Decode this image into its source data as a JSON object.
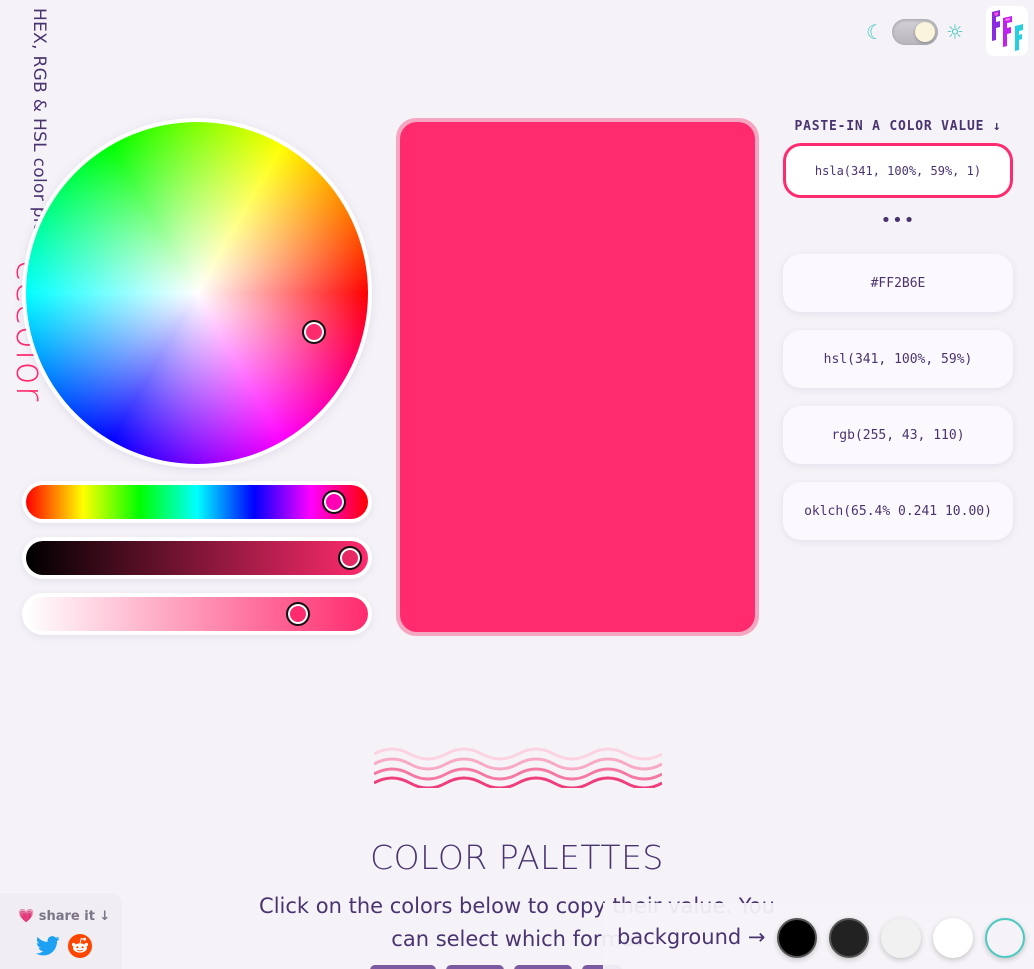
{
  "brand": {
    "name": "cccolor",
    "subtitle": "HEX, RGB & HSL color picker"
  },
  "theme": {
    "moon_glyph": "☾",
    "sun_glyph": "☼",
    "mode": "light"
  },
  "current_color": {
    "hex": "#FF2B6E",
    "display": "#ff2b6e"
  },
  "picker": {
    "hue_handle_color": "#ff2b6e",
    "saturation_level_percent": 100,
    "lightness_level_percent": 59,
    "alpha_level_percent": 100
  },
  "formats": {
    "paste_label": "PASTE-IN A COLOR VALUE ↓",
    "input_value": "hsla(341, 100%, 59%, 1)",
    "more": "•••",
    "items": [
      {
        "label": "#FF2B6E"
      },
      {
        "label": "hsl(341, 100%, 59%)"
      },
      {
        "label": "rgb(255, 43, 110)"
      },
      {
        "label": "oklch(65.4% 0.241 10.00)"
      }
    ]
  },
  "palettes": {
    "title": "COLOR PALETTES",
    "description": "Click on the colors below to copy their value. You can select which format"
  },
  "share": {
    "heart": "💗",
    "label": "share it ↓"
  },
  "background": {
    "label": "background →",
    "swatches": [
      {
        "name": "black",
        "color": "#000000"
      },
      {
        "name": "dark",
        "color": "#222222"
      },
      {
        "name": "light",
        "color": "#f1f1f1"
      },
      {
        "name": "white",
        "color": "#ffffff"
      },
      {
        "name": "teal-outline",
        "color": "#4cc9c0"
      }
    ]
  },
  "colors": {
    "accent": "#ff2b6e",
    "text": "#4a3470",
    "teal": "#4cc9c0"
  }
}
